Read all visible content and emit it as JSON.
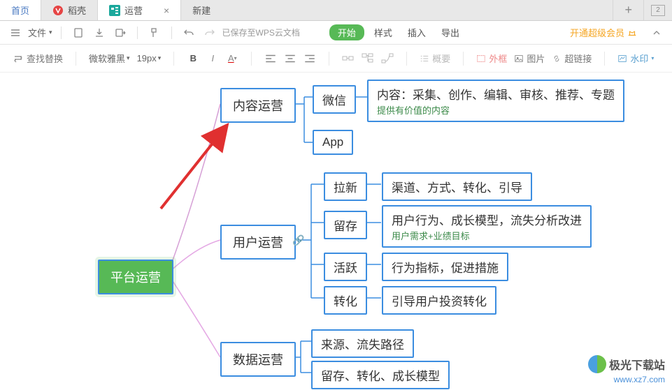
{
  "tabs": {
    "home": "首页",
    "docer": "稻壳",
    "active": "运营",
    "new": "新建",
    "windowCount": "2"
  },
  "toolbar": {
    "file": "文件",
    "saveStatus": "已保存至WPS云文档",
    "start": "开始",
    "style": "样式",
    "insert": "插入",
    "export": "导出",
    "vip": "开通超级会员"
  },
  "toolbar2": {
    "find": "查找替换",
    "font": "微软雅黑",
    "size": "19px",
    "outline": "概要",
    "border": "外框",
    "image": "图片",
    "hyperlink": "超链接",
    "watermark": "水印"
  },
  "mindmap": {
    "root": "平台运营",
    "content": {
      "label": "内容运营",
      "wechat": "微信",
      "app": "App",
      "detail": "内容：采集、创作、编辑、审核、推荐、专题",
      "note": "提供有价值的内容"
    },
    "user": {
      "label": "用户运营",
      "pull": "拉新",
      "pullDetail": "渠道、方式、转化、引导",
      "retain": "留存",
      "retainDetail": "用户行为、成长模型，流失分析改进",
      "retainNote": "用户需求+业绩目标",
      "active": "活跃",
      "activeDetail": "行为指标，促进措施",
      "convert": "转化",
      "convertDetail": "引导用户投资转化"
    },
    "data": {
      "label": "数据运营",
      "source": "来源、流失路径",
      "model": "留存、转化、成长模型"
    }
  },
  "watermark": {
    "brand": "极光下载站",
    "url": "www.xz7.com"
  }
}
